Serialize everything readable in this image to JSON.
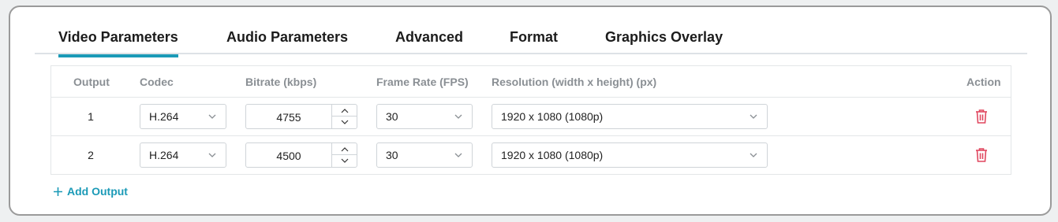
{
  "tabs": [
    {
      "label": "Video Parameters",
      "active": true
    },
    {
      "label": "Audio Parameters",
      "active": false
    },
    {
      "label": "Advanced",
      "active": false
    },
    {
      "label": "Format",
      "active": false
    },
    {
      "label": "Graphics Overlay",
      "active": false
    }
  ],
  "table": {
    "headers": {
      "output": "Output",
      "codec": "Codec",
      "bitrate": "Bitrate (kbps)",
      "frame_rate": "Frame Rate (FPS)",
      "resolution": "Resolution (width x height) (px)",
      "action": "Action"
    },
    "rows": [
      {
        "output": "1",
        "codec": "H.264",
        "bitrate": "4755",
        "frame_rate": "30",
        "resolution": "1920 x 1080 (1080p)"
      },
      {
        "output": "2",
        "codec": "H.264",
        "bitrate": "4500",
        "frame_rate": "30",
        "resolution": "1920 x 1080 (1080p)"
      }
    ]
  },
  "add_output_label": "Add Output",
  "icons": {
    "chevron": "chevron-down-icon",
    "stepper_up": "chevron-up-icon",
    "stepper_down": "chevron-down-icon",
    "delete": "trash-icon",
    "add": "plus-icon"
  },
  "colors": {
    "accent": "#1b9ab7",
    "delete": "#e0475f",
    "header_text": "#8a8f94",
    "border": "#cfd4d8"
  }
}
